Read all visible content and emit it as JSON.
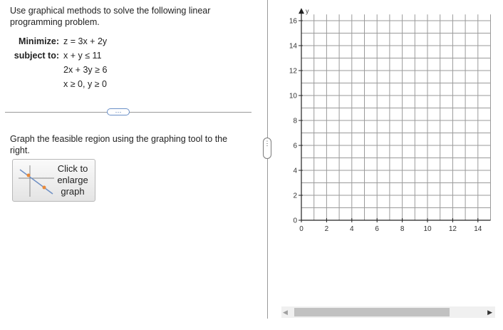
{
  "problem": {
    "intro": "Use graphical methods to solve the following linear programming problem.",
    "objective_label": "Minimize:",
    "objective": "z = 3x + 2y",
    "subject_label": "subject to:",
    "constraints": [
      "x + y ≤ 11",
      "2x + 3y ≥ 6",
      "x ≥ 0, y ≥ 0"
    ]
  },
  "expand_button": "···",
  "instruction": "Graph the feasible region using the graphing tool to the right.",
  "enlarge_button": {
    "line1": "Click to",
    "line2": "enlarge",
    "line3": "graph"
  },
  "splitter_handle": "⋮",
  "graph": {
    "axis_y_label": "y",
    "x_min": 0,
    "x_max": 15,
    "y_min": 0,
    "y_max": 16.5,
    "x_ticks": [
      "0",
      "2",
      "4",
      "6",
      "8",
      "10",
      "12",
      "14"
    ],
    "y_ticks": [
      "0",
      "2",
      "4",
      "6",
      "8",
      "10",
      "12",
      "14",
      "16"
    ],
    "grid_step": 1,
    "grid_color": "#9a9a9a"
  },
  "scrollbar": {
    "left_arrow": "◀",
    "right_arrow": "▶"
  }
}
